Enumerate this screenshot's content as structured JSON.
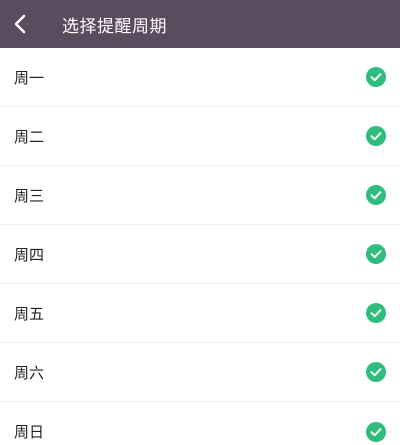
{
  "header": {
    "title": "选择提醒周期",
    "back_icon": "chevron-left-icon",
    "background_color": "#5b4b5f"
  },
  "days": [
    {
      "label": "周一",
      "selected": true
    },
    {
      "label": "周二",
      "selected": true
    },
    {
      "label": "周三",
      "selected": true
    },
    {
      "label": "周四",
      "selected": true
    },
    {
      "label": "周五",
      "selected": true
    },
    {
      "label": "周六",
      "selected": true
    },
    {
      "label": "周日",
      "selected": true
    }
  ],
  "check_icon": "check-circle-icon",
  "check_color": "#2ebd7c"
}
